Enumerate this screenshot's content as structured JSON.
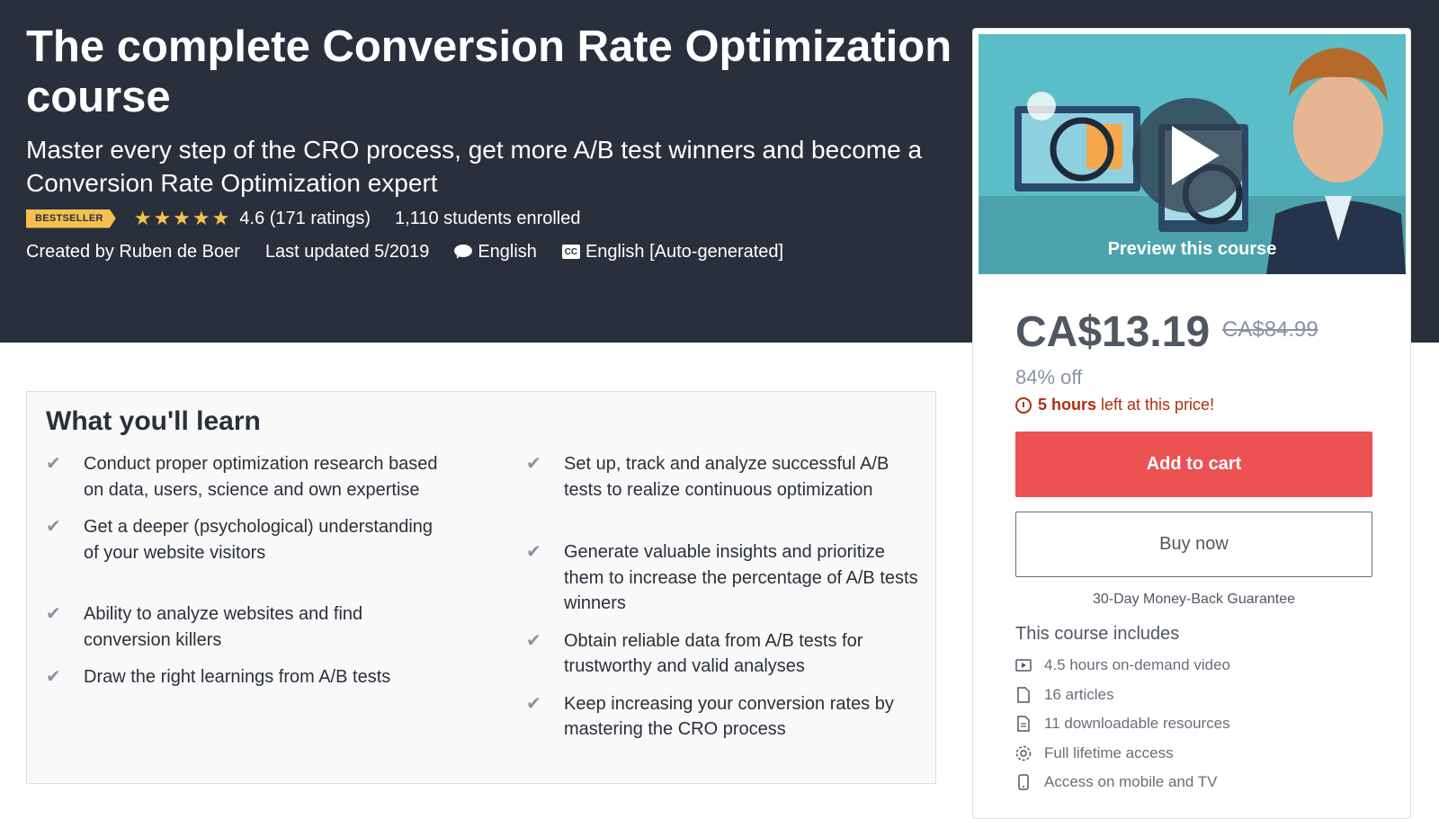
{
  "course": {
    "title": "The complete Conversion Rate Optimization course",
    "subtitle": "Master every step of the CRO process, get more A/B test winners and become a Conversion Rate Optimization expert",
    "badge": "BESTSELLER",
    "rating": 4.6,
    "rating_text": "4.6 (171 ratings)",
    "enrolled": "1,110 students enrolled",
    "created_by": "Created by Ruben de Boer",
    "last_updated": "Last updated 5/2019",
    "language": "English",
    "captions": "English [Auto-generated]"
  },
  "preview": {
    "label": "Preview this course"
  },
  "pricing": {
    "current": "CA$13.19",
    "original": "CA$84.99",
    "discount": "84% off",
    "timer_bold": "5 hours",
    "timer_rest": " left at this price!",
    "add_to_cart": "Add to cart",
    "buy_now": "Buy now",
    "guarantee": "30-Day Money-Back Guarantee"
  },
  "includes": {
    "title": "This course includes",
    "items": [
      {
        "icon": "video-icon",
        "label": "4.5 hours on-demand video"
      },
      {
        "icon": "file-icon",
        "label": "16 articles"
      },
      {
        "icon": "document-icon",
        "label": "11 downloadable resources"
      },
      {
        "icon": "infinity-icon",
        "label": "Full lifetime access"
      },
      {
        "icon": "mobile-icon",
        "label": "Access on mobile and TV"
      }
    ]
  },
  "learn": {
    "title": "What you'll learn",
    "left": [
      "Conduct proper optimization research based on data, users, science and own expertise",
      "Get a deeper (psychological) understanding of your website visitors",
      "Ability to analyze websites and find conversion killers",
      "Draw the right learnings from A/B tests"
    ],
    "right": [
      "Set up, track and analyze successful A/B tests to realize continuous optimization",
      "Generate valuable insights and prioritize them to increase the percentage of A/B tests winners",
      "Obtain reliable data from A/B tests for trustworthy and valid analyses",
      "Keep increasing your conversion rates by mastering the CRO process"
    ]
  },
  "colors": {
    "hero_bg": "#29303b",
    "badge": "#f4c150",
    "star": "#f4c150",
    "cta": "#ec5252",
    "timer": "#b32d0f"
  }
}
